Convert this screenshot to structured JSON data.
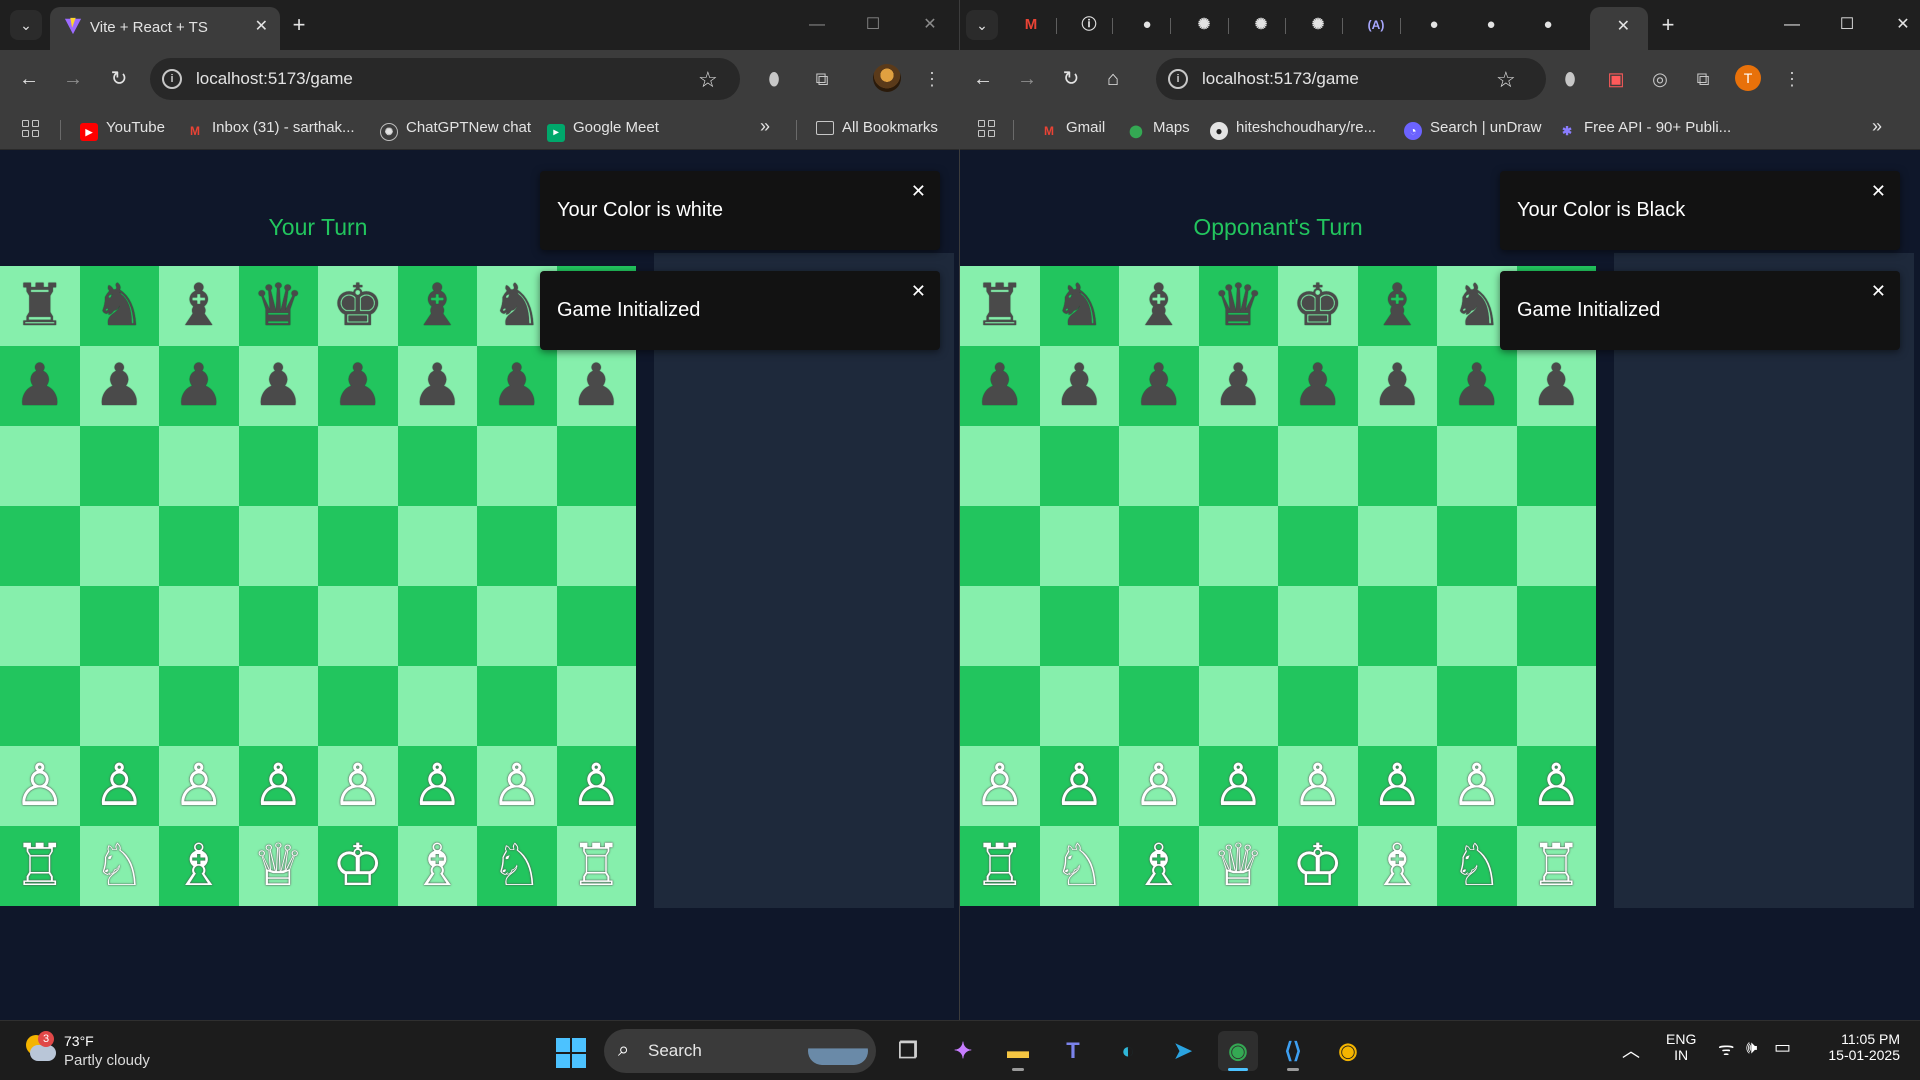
{
  "left_window": {
    "tab_title": "Vite + React + TS",
    "url": "localhost:5173/game",
    "bookmarks": [
      "YouTube",
      "Inbox (31) - sarthak...",
      "ChatGPTNew chat",
      "Google Meet"
    ],
    "all_bookmarks": "All Bookmarks",
    "turn_label": "Your Turn",
    "toasts": [
      "Your Color is white",
      "Game Initialized"
    ]
  },
  "right_window": {
    "url": "localhost:5173/game",
    "avatar_letter": "T",
    "bookmarks": [
      "Gmail",
      "Maps",
      "hiteshchoudhary/re...",
      "Search | unDraw",
      "Free API - 90+ Publi..."
    ],
    "turn_label": "Opponant's Turn",
    "toasts": [
      "Your Color is Black",
      "Game Initialized"
    ]
  },
  "board": [
    [
      "♜",
      "♞",
      "♝",
      "♛",
      "♚",
      "♝",
      "♞",
      "♜"
    ],
    [
      "♟",
      "♟",
      "♟",
      "♟",
      "♟",
      "♟",
      "♟",
      "♟"
    ],
    [
      "",
      "",
      "",
      "",
      "",
      "",
      "",
      ""
    ],
    [
      "",
      "",
      "",
      "",
      "",
      "",
      "",
      ""
    ],
    [
      "",
      "",
      "",
      "",
      "",
      "",
      "",
      ""
    ],
    [
      "",
      "",
      "",
      "",
      "",
      "",
      "",
      ""
    ],
    [
      "♙",
      "♙",
      "♙",
      "♙",
      "♙",
      "♙",
      "♙",
      "♙"
    ],
    [
      "♖",
      "♘",
      "♗",
      "♕",
      "♔",
      "♗",
      "♘",
      "♖"
    ]
  ],
  "colors": {
    "light_square": "#86efac",
    "dark_square": "#22c55e",
    "turn_text": "#22c55e",
    "page_bg": "#0f172a",
    "panel_bg": "#1e293b"
  },
  "taskbar": {
    "weather_temp": "73°F",
    "weather_desc": "Partly cloudy",
    "weather_badge": "3",
    "search_label": "Search",
    "language": "ENG",
    "region": "IN",
    "time": "11:05 PM",
    "date": "15-01-2025",
    "apps": [
      "task-view-icon",
      "copilot-icon",
      "file-explorer-icon",
      "teams-icon",
      "edge-icon",
      "telegram-icon",
      "chrome-icon",
      "vscode-icon",
      "chrome-dev-icon"
    ]
  }
}
